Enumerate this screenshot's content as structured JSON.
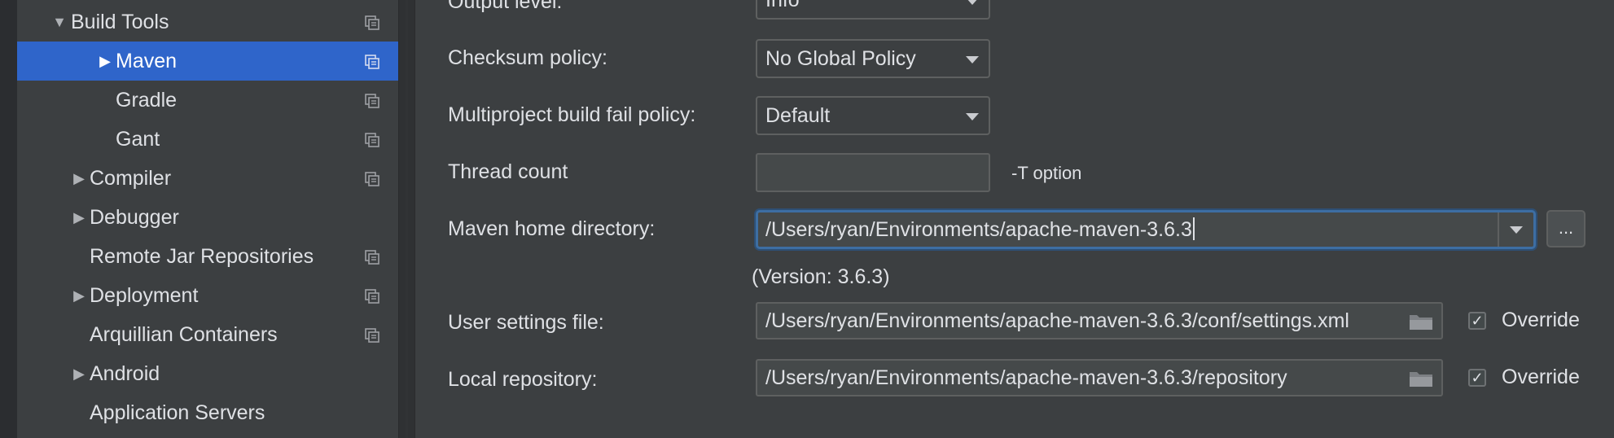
{
  "sidebar": {
    "items": [
      {
        "label": "Build Tools",
        "arrow": "▼",
        "has_project_icon": true
      },
      {
        "label": "Maven",
        "arrow": "▶",
        "has_project_icon": true,
        "selected": true
      },
      {
        "label": "Gradle",
        "arrow": "",
        "has_project_icon": true
      },
      {
        "label": "Gant",
        "arrow": "",
        "has_project_icon": true
      },
      {
        "label": "Compiler",
        "arrow": "▶",
        "has_project_icon": true
      },
      {
        "label": "Debugger",
        "arrow": "▶",
        "has_project_icon": false
      },
      {
        "label": "Remote Jar Repositories",
        "arrow": "",
        "has_project_icon": true
      },
      {
        "label": "Deployment",
        "arrow": "▶",
        "has_project_icon": true
      },
      {
        "label": "Arquillian Containers",
        "arrow": "",
        "has_project_icon": true
      },
      {
        "label": "Android",
        "arrow": "▶",
        "has_project_icon": false
      },
      {
        "label": "Application Servers",
        "arrow": "",
        "has_project_icon": false
      }
    ]
  },
  "form": {
    "output_level": {
      "label": "Output level:",
      "value": "Info"
    },
    "checksum_policy": {
      "label": "Checksum policy:",
      "value": "No Global Policy"
    },
    "multiproject_fail_policy": {
      "label": "Multiproject build fail policy:",
      "value": "Default"
    },
    "thread_count": {
      "label": "Thread count",
      "value": "",
      "hint": "-T option"
    },
    "maven_home": {
      "label": "Maven home directory:",
      "value": "/Users/ryan/Environments/apache-maven-3.6.3",
      "browse_label": "...",
      "version": "(Version: 3.6.3)"
    },
    "user_settings": {
      "label": "User settings file:",
      "value": "/Users/ryan/Environments/apache-maven-3.6.3/conf/settings.xml",
      "override_label": "Override",
      "override_checked": "✓"
    },
    "local_repository": {
      "label": "Local repository:",
      "value": "/Users/ryan/Environments/apache-maven-3.6.3/repository",
      "override_label": "Override",
      "override_checked": "✓"
    }
  },
  "colors": {
    "background": "#3c3f41",
    "selection": "#2f65ca",
    "focus_border": "#3d6ea3",
    "text": "#dfe1e5"
  }
}
